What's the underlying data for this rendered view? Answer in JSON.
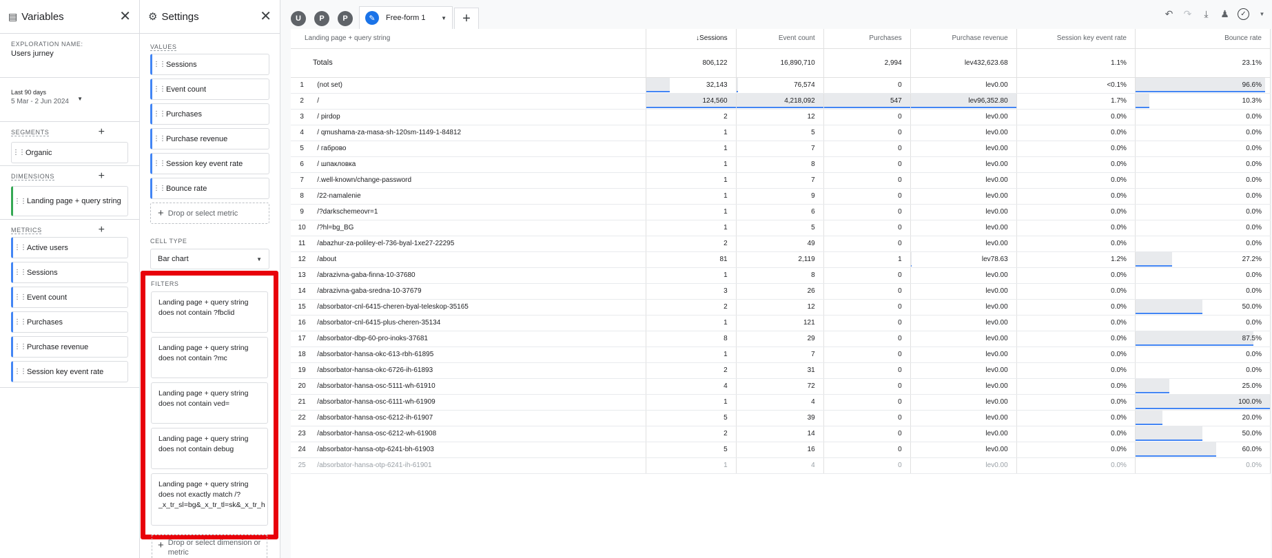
{
  "variables_panel": {
    "title": "Variables",
    "exploration_label": "EXPLORATION NAME:",
    "exploration_name": "Users jurney",
    "date_label": "Last 90 days",
    "date_range": "5 Mar - 2 Jun 2024",
    "segments_label": "SEGMENTS",
    "segments": [
      "Organic"
    ],
    "dimensions_label": "DIMENSIONS",
    "dimensions": [
      "Landing page + query string"
    ],
    "metrics_label": "METRICS",
    "metrics": [
      "Active users",
      "Sessions",
      "Event count",
      "Purchases",
      "Purchase revenue",
      "Session key event rate"
    ]
  },
  "settings_panel": {
    "title": "Settings",
    "values_label": "VALUES",
    "values": [
      "Sessions",
      "Event count",
      "Purchases",
      "Purchase revenue",
      "Session key event rate",
      "Bounce rate"
    ],
    "drop_metric": "Drop or select metric",
    "cell_type_label": "CELL TYPE",
    "cell_type": "Bar chart",
    "filters_label": "FILTERS",
    "filters": [
      "Landing page + query string does not contain ?fbclid",
      "Landing page + query string does not contain ?mc",
      "Landing page + query string does not contain ved=",
      "Landing page + query string does not contain debug",
      "Landing page + query string does not exactly match /?_x_tr_sl=bg&_x_tr_tl=sk&_x_tr_h"
    ],
    "drop_filter": "Drop or select dimension or metric"
  },
  "tabs": {
    "circles": [
      "U",
      "P",
      "P"
    ],
    "active_tab": "Free-form 1",
    "add": "+"
  },
  "table": {
    "headers": {
      "dimension": "Landing page + query string",
      "sessions": "Sessions",
      "event_count": "Event count",
      "purchases": "Purchases",
      "revenue": "Purchase revenue",
      "key_rate": "Session key event rate",
      "bounce": "Bounce rate"
    },
    "totals": {
      "label": "Totals",
      "sessions": "806,122",
      "event_count": "16,890,710",
      "purchases": "2,994",
      "revenue": "lev432,623.68",
      "key_rate": "1.1%",
      "bounce": "23.1%"
    },
    "rows": [
      {
        "n": "1",
        "page": "(not set)",
        "sessions": "32,143",
        "events": "76,574",
        "purchases": "0",
        "revenue": "lev0.00",
        "rate": "<0.1%",
        "bounce": "96.6%",
        "s_bar": 0.26,
        "e_bar": 0.02,
        "p_bar": 0,
        "r_bar": 0,
        "b_bar": 0.966
      },
      {
        "n": "2",
        "page": "/",
        "sessions": "124,560",
        "events": "4,218,092",
        "purchases": "547",
        "revenue": "lev96,352.80",
        "rate": "1.7%",
        "bounce": "10.3%",
        "s_bar": 1,
        "e_bar": 1,
        "p_bar": 1,
        "r_bar": 1,
        "b_bar": 0.103
      },
      {
        "n": "3",
        "page": "/ pirdop",
        "sessions": "2",
        "events": "12",
        "purchases": "0",
        "revenue": "lev0.00",
        "rate": "0.0%",
        "bounce": "0.0%",
        "s_bar": 0,
        "e_bar": 0,
        "p_bar": 0,
        "r_bar": 0,
        "b_bar": 0
      },
      {
        "n": "4",
        "page": "/ qmushama-za-masa-sh-120sm-1149-1-84812",
        "sessions": "1",
        "events": "5",
        "purchases": "0",
        "revenue": "lev0.00",
        "rate": "0.0%",
        "bounce": "0.0%",
        "s_bar": 0,
        "e_bar": 0,
        "p_bar": 0,
        "r_bar": 0,
        "b_bar": 0
      },
      {
        "n": "5",
        "page": "/ габрово",
        "sessions": "1",
        "events": "7",
        "purchases": "0",
        "revenue": "lev0.00",
        "rate": "0.0%",
        "bounce": "0.0%",
        "s_bar": 0,
        "e_bar": 0,
        "p_bar": 0,
        "r_bar": 0,
        "b_bar": 0
      },
      {
        "n": "6",
        "page": "/ шпакловка",
        "sessions": "1",
        "events": "8",
        "purchases": "0",
        "revenue": "lev0.00",
        "rate": "0.0%",
        "bounce": "0.0%",
        "s_bar": 0,
        "e_bar": 0,
        "p_bar": 0,
        "r_bar": 0,
        "b_bar": 0
      },
      {
        "n": "7",
        "page": "/.well-known/change-password",
        "sessions": "1",
        "events": "7",
        "purchases": "0",
        "revenue": "lev0.00",
        "rate": "0.0%",
        "bounce": "0.0%",
        "s_bar": 0,
        "e_bar": 0,
        "p_bar": 0,
        "r_bar": 0,
        "b_bar": 0
      },
      {
        "n": "8",
        "page": "/22-namalenie",
        "sessions": "1",
        "events": "9",
        "purchases": "0",
        "revenue": "lev0.00",
        "rate": "0.0%",
        "bounce": "0.0%",
        "s_bar": 0,
        "e_bar": 0,
        "p_bar": 0,
        "r_bar": 0,
        "b_bar": 0
      },
      {
        "n": "9",
        "page": "/?darkschemeovr=1",
        "sessions": "1",
        "events": "6",
        "purchases": "0",
        "revenue": "lev0.00",
        "rate": "0.0%",
        "bounce": "0.0%",
        "s_bar": 0,
        "e_bar": 0,
        "p_bar": 0,
        "r_bar": 0,
        "b_bar": 0
      },
      {
        "n": "10",
        "page": "/?hl=bg_BG",
        "sessions": "1",
        "events": "5",
        "purchases": "0",
        "revenue": "lev0.00",
        "rate": "0.0%",
        "bounce": "0.0%",
        "s_bar": 0,
        "e_bar": 0,
        "p_bar": 0,
        "r_bar": 0,
        "b_bar": 0
      },
      {
        "n": "11",
        "page": "/abazhur-za-poliley-el-736-byal-1xe27-22295",
        "sessions": "2",
        "events": "49",
        "purchases": "0",
        "revenue": "lev0.00",
        "rate": "0.0%",
        "bounce": "0.0%",
        "s_bar": 0,
        "e_bar": 0,
        "p_bar": 0,
        "r_bar": 0,
        "b_bar": 0
      },
      {
        "n": "12",
        "page": "/about",
        "sessions": "81",
        "events": "2,119",
        "purchases": "1",
        "revenue": "lev78.63",
        "rate": "1.2%",
        "bounce": "27.2%",
        "s_bar": 0,
        "e_bar": 0,
        "p_bar": 0,
        "r_bar": 0.001,
        "b_bar": 0.272
      },
      {
        "n": "13",
        "page": "/abrazivna-gaba-finna-10-37680",
        "sessions": "1",
        "events": "8",
        "purchases": "0",
        "revenue": "lev0.00",
        "rate": "0.0%",
        "bounce": "0.0%",
        "s_bar": 0,
        "e_bar": 0,
        "p_bar": 0,
        "r_bar": 0,
        "b_bar": 0
      },
      {
        "n": "14",
        "page": "/abrazivna-gaba-sredna-10-37679",
        "sessions": "3",
        "events": "26",
        "purchases": "0",
        "revenue": "lev0.00",
        "rate": "0.0%",
        "bounce": "0.0%",
        "s_bar": 0,
        "e_bar": 0,
        "p_bar": 0,
        "r_bar": 0,
        "b_bar": 0
      },
      {
        "n": "15",
        "page": "/absorbator-cnl-6415-cheren-byal-teleskop-35165",
        "sessions": "2",
        "events": "12",
        "purchases": "0",
        "revenue": "lev0.00",
        "rate": "0.0%",
        "bounce": "50.0%",
        "s_bar": 0,
        "e_bar": 0,
        "p_bar": 0,
        "r_bar": 0,
        "b_bar": 0.5
      },
      {
        "n": "16",
        "page": "/absorbator-cnl-6415-plus-cheren-35134",
        "sessions": "1",
        "events": "121",
        "purchases": "0",
        "revenue": "lev0.00",
        "rate": "0.0%",
        "bounce": "0.0%",
        "s_bar": 0,
        "e_bar": 0,
        "p_bar": 0,
        "r_bar": 0,
        "b_bar": 0
      },
      {
        "n": "17",
        "page": "/absorbator-dbp-60-pro-inoks-37681",
        "sessions": "8",
        "events": "29",
        "purchases": "0",
        "revenue": "lev0.00",
        "rate": "0.0%",
        "bounce": "87.5%",
        "s_bar": 0,
        "e_bar": 0,
        "p_bar": 0,
        "r_bar": 0,
        "b_bar": 0.875
      },
      {
        "n": "18",
        "page": "/absorbator-hansa-okc-613-rbh-61895",
        "sessions": "1",
        "events": "7",
        "purchases": "0",
        "revenue": "lev0.00",
        "rate": "0.0%",
        "bounce": "0.0%",
        "s_bar": 0,
        "e_bar": 0,
        "p_bar": 0,
        "r_bar": 0,
        "b_bar": 0
      },
      {
        "n": "19",
        "page": "/absorbator-hansa-okc-6726-ih-61893",
        "sessions": "2",
        "events": "31",
        "purchases": "0",
        "revenue": "lev0.00",
        "rate": "0.0%",
        "bounce": "0.0%",
        "s_bar": 0,
        "e_bar": 0,
        "p_bar": 0,
        "r_bar": 0,
        "b_bar": 0
      },
      {
        "n": "20",
        "page": "/absorbator-hansa-osc-5111-wh-61910",
        "sessions": "4",
        "events": "72",
        "purchases": "0",
        "revenue": "lev0.00",
        "rate": "0.0%",
        "bounce": "25.0%",
        "s_bar": 0,
        "e_bar": 0,
        "p_bar": 0,
        "r_bar": 0,
        "b_bar": 0.25
      },
      {
        "n": "21",
        "page": "/absorbator-hansa-osc-6111-wh-61909",
        "sessions": "1",
        "events": "4",
        "purchases": "0",
        "revenue": "lev0.00",
        "rate": "0.0%",
        "bounce": "100.0%",
        "s_bar": 0,
        "e_bar": 0,
        "p_bar": 0,
        "r_bar": 0,
        "b_bar": 1
      },
      {
        "n": "22",
        "page": "/absorbator-hansa-osc-6212-ih-61907",
        "sessions": "5",
        "events": "39",
        "purchases": "0",
        "revenue": "lev0.00",
        "rate": "0.0%",
        "bounce": "20.0%",
        "s_bar": 0,
        "e_bar": 0,
        "p_bar": 0,
        "r_bar": 0,
        "b_bar": 0.2
      },
      {
        "n": "23",
        "page": "/absorbator-hansa-osc-6212-wh-61908",
        "sessions": "2",
        "events": "14",
        "purchases": "0",
        "revenue": "lev0.00",
        "rate": "0.0%",
        "bounce": "50.0%",
        "s_bar": 0,
        "e_bar": 0,
        "p_bar": 0,
        "r_bar": 0,
        "b_bar": 0.5
      },
      {
        "n": "24",
        "page": "/absorbator-hansa-otp-6241-bh-61903",
        "sessions": "5",
        "events": "16",
        "purchases": "0",
        "revenue": "lev0.00",
        "rate": "0.0%",
        "bounce": "60.0%",
        "s_bar": 0,
        "e_bar": 0,
        "p_bar": 0,
        "r_bar": 0,
        "b_bar": 0.6
      },
      {
        "n": "25",
        "page": "/absorbator-hansa-otp-6241-ih-61901",
        "sessions": "1",
        "events": "4",
        "purchases": "0",
        "revenue": "lev0.00",
        "rate": "0.0%",
        "bounce": "0.0%",
        "s_bar": 0,
        "e_bar": 0,
        "p_bar": 0,
        "r_bar": 0,
        "b_bar": 0
      }
    ]
  }
}
